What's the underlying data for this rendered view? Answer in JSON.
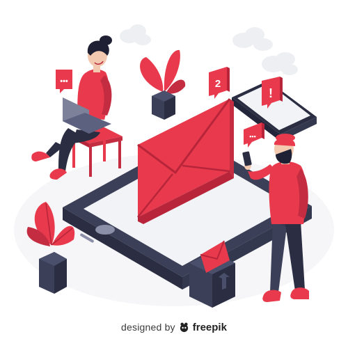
{
  "illustration": {
    "subject": "isometric-email-notifications",
    "colors": {
      "accent": "#e83a4c",
      "accent_dark": "#b8253a",
      "navy": "#3b3f57",
      "navy_dark": "#2b2e42",
      "screen": "#f2f3f6",
      "cloud": "#eeeff2",
      "skin": "#f3c9b0",
      "hair": "#1f2033"
    },
    "badges": [
      {
        "name": "chat-bubble-icon",
        "text": "•••"
      },
      {
        "name": "notification-count-badge",
        "text": "2"
      },
      {
        "name": "alert-badge",
        "text": "!"
      },
      {
        "name": "message-dots-badge",
        "text": "•••"
      }
    ]
  },
  "credit": {
    "designed_label": "designed by",
    "brand": "freepik",
    "logo_icon": "freepik-logo-icon"
  }
}
